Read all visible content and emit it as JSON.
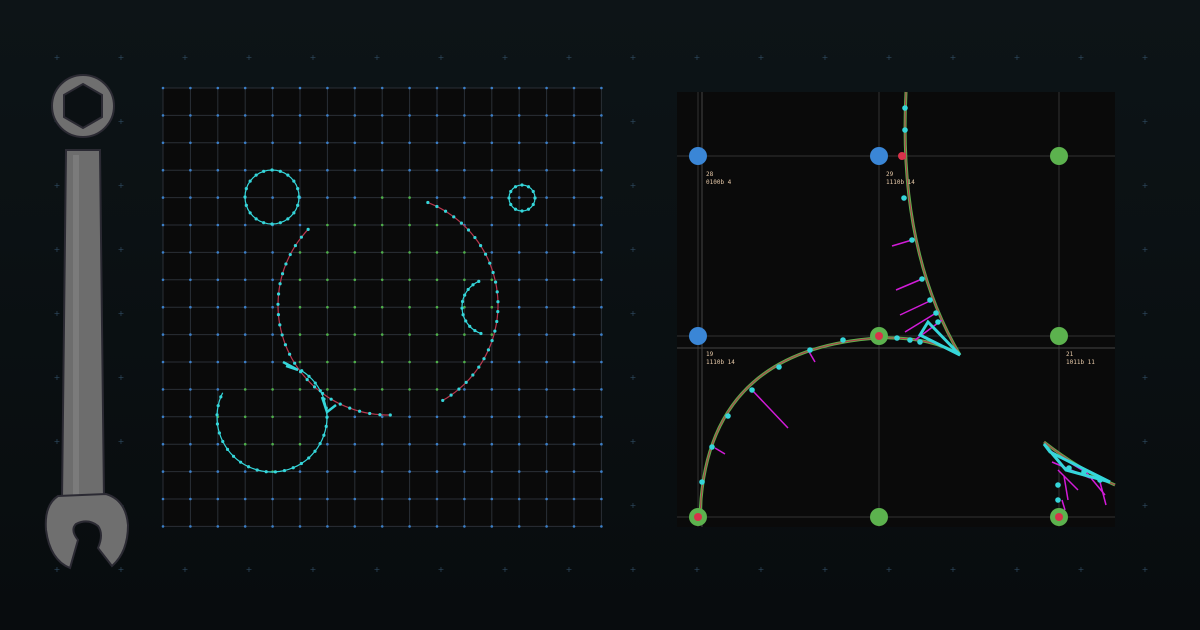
{
  "icon": "wrench-icon",
  "colors": {
    "background": "#0b1114",
    "panel": "#0a0a0a",
    "cyan": "#35d6da",
    "path_red": "#b8384f",
    "path_green": "#5fae4b",
    "magenta": "#d21bd8",
    "node_blue": "#3a86d6",
    "node_green": "#5cb24e",
    "node_red": "#d8324a",
    "wrench": "#6f6f6f"
  },
  "right_panel": {
    "nodes": [
      {
        "id": "28",
        "code": "0100b 4"
      },
      {
        "id": "29",
        "code": "1110b 14"
      },
      {
        "id": "19",
        "code": "1110b 14"
      },
      {
        "id": "21",
        "code": "1011b 11"
      }
    ]
  }
}
